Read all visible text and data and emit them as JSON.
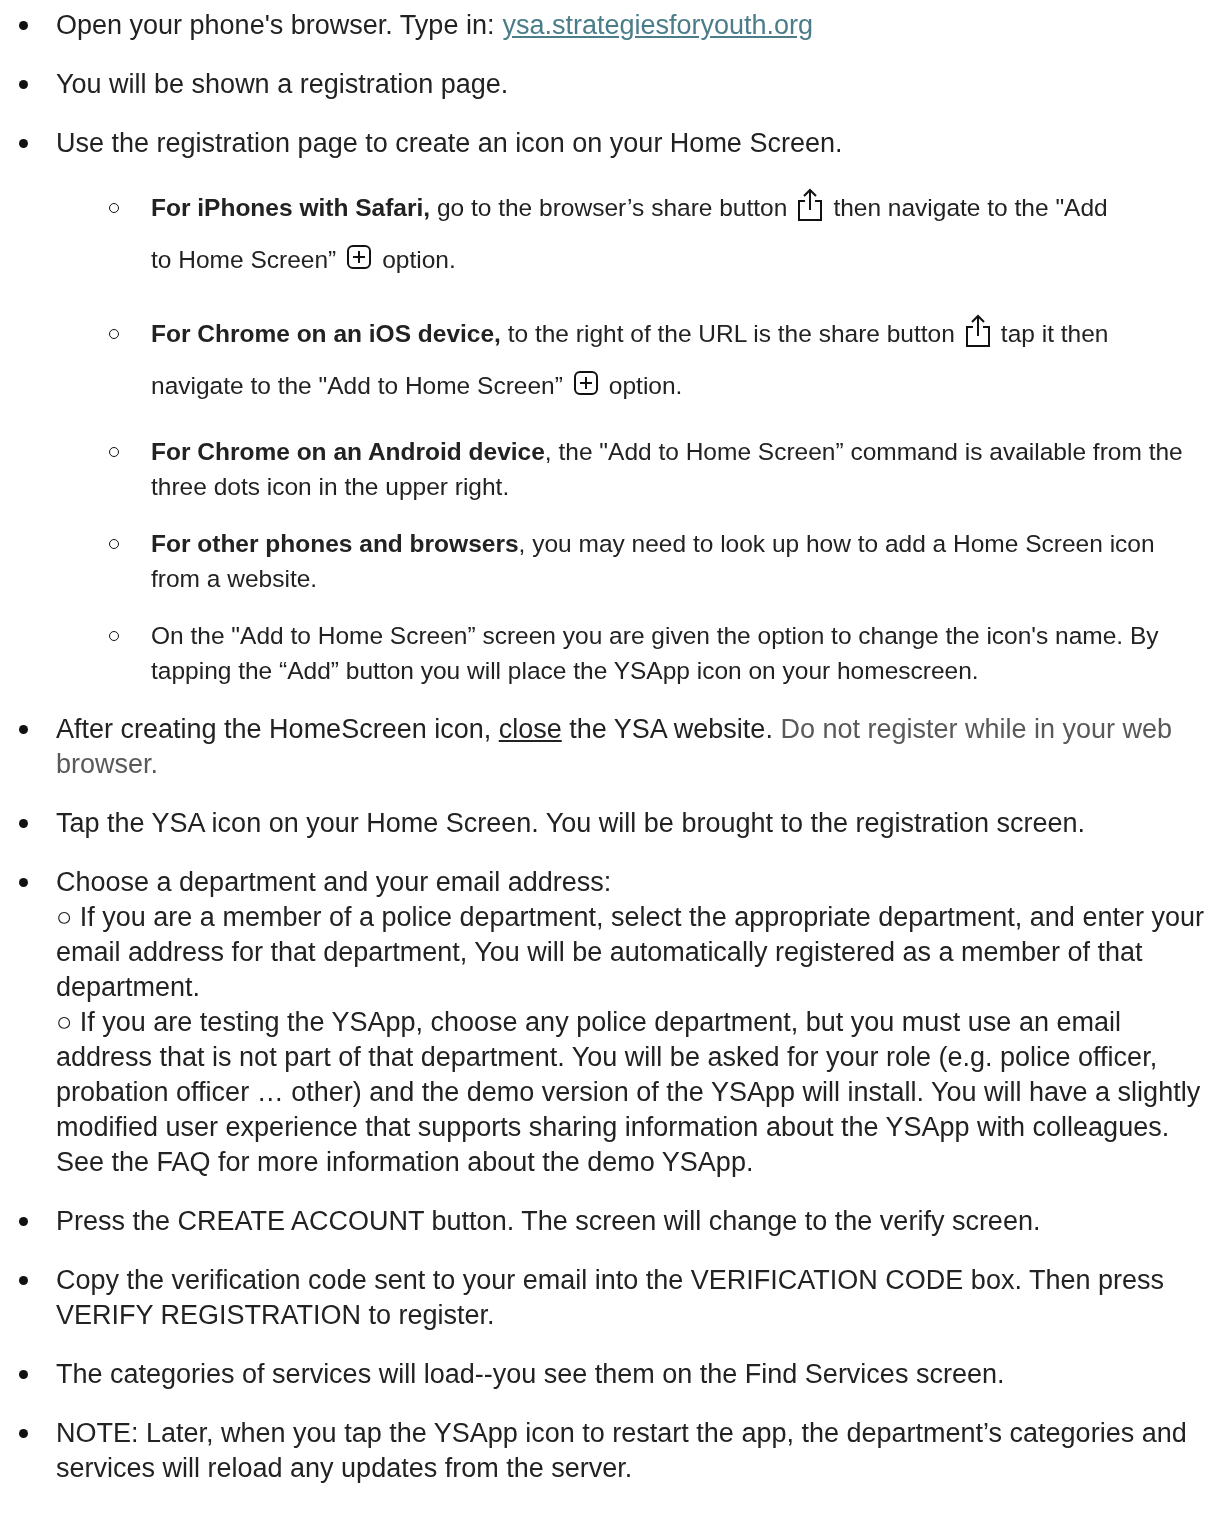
{
  "items": [
    {
      "kind": "bullet",
      "parts": [
        {
          "kind": "text",
          "text": "Open your phone's browser. Type in: "
        },
        {
          "kind": "link",
          "text": "ysa.strategiesforyouth.org"
        }
      ]
    },
    {
      "kind": "bullet",
      "parts": [
        {
          "kind": "text",
          "text": "You will be shown a registration page."
        }
      ]
    },
    {
      "kind": "bullet",
      "parts": [
        {
          "kind": "text",
          "text": "Use the registration page to create an icon on your Home Screen."
        }
      ],
      "children": [
        {
          "lines": [
            [
              {
                "kind": "text",
                "text": "**For iPhones with Safari,** go to the browser’s share button"
              },
              {
                "kind": "share"
              },
              {
                "kind": "text",
                "text": "then navigate to the \"Add"
              }
            ],
            [
              {
                "kind": "text",
                "text": "to Home Screen”"
              },
              {
                "kind": "plus"
              },
              {
                "kind": "text",
                "text": "option."
              }
            ]
          ]
        },
        {
          "lines": [
            [
              {
                "kind": "text",
                "text": "**For Chrome on an iOS device,** to the right of the URL is the share button"
              },
              {
                "kind": "share"
              },
              {
                "kind": "text",
                "text": "tap it then"
              }
            ],
            [
              {
                "kind": "text",
                "text": "navigate to the \"Add to Home Screen”"
              },
              {
                "kind": "plus"
              },
              {
                "kind": "text",
                "text": "option."
              }
            ]
          ]
        },
        {
          "parts": [
            {
              "kind": "text",
              "text": "**For Chrome on an Android device**, the \"Add to Home Screen” command is available from the three dots icon in the upper right."
            }
          ]
        },
        {
          "parts": [
            {
              "kind": "text",
              "text": "**For other phones and browsers**, you may need to look up how to add a Home Screen icon from a website."
            }
          ]
        },
        {
          "parts": [
            {
              "kind": "text",
              "text": "On the \"Add to Home Screen” screen you are given the option to change the icon's name. By tapping the “Add” button you will place the YSApp icon on your homescreen."
            }
          ]
        }
      ]
    },
    {
      "kind": "bullet",
      "parts": [
        {
          "kind": "text",
          "text": "After creating the HomeScreen icon, "
        },
        {
          "kind": "underline",
          "text": "close"
        },
        {
          "kind": "text",
          "text": " the YSA website. "
        },
        {
          "kind": "muted",
          "text": "Do not register while in your web browser."
        }
      ]
    },
    {
      "kind": "bullet",
      "parts": [
        {
          "kind": "text",
          "text": "Tap the YSA icon on your Home Screen. You will be brought to the registration screen."
        }
      ]
    },
    {
      "kind": "lines",
      "lines": [
        "Choose a department and your email address:",
        "○ If you are a member of a police department, select the appropriate department, and enter your email address for that department,  You will be automatically registered as a member of that department.",
        "○ If you are testing the YSApp, choose any police department, but you must use an email address that is not part of that department. You will be asked for your role (e.g. police officer, probation officer … other) and the demo version of the YSApp will install.  You will have a slightly modified user experience that supports sharing information about the YSApp with colleagues. See the FAQ for more information about the demo YSApp."
      ]
    },
    {
      "kind": "bullet",
      "parts": [
        {
          "kind": "text",
          "text": "Press the CREATE ACCOUNT button. The screen will change to the verify screen."
        }
      ]
    },
    {
      "kind": "bullet",
      "parts": [
        {
          "kind": "text",
          "text": "Copy the verification code sent to your email into the VERIFICATION CODE box. Then press VERIFY REGISTRATION to register."
        }
      ]
    },
    {
      "kind": "bullet",
      "parts": [
        {
          "kind": "text",
          "text": "The categories of services will load--you see them on the Find Services screen."
        }
      ]
    },
    {
      "kind": "bullet",
      "parts": [
        {
          "kind": "text",
          "text": "NOTE: Later, when you tap the YSApp icon to restart the app, the department’s categories and services will reload any updates from the server."
        }
      ]
    }
  ]
}
